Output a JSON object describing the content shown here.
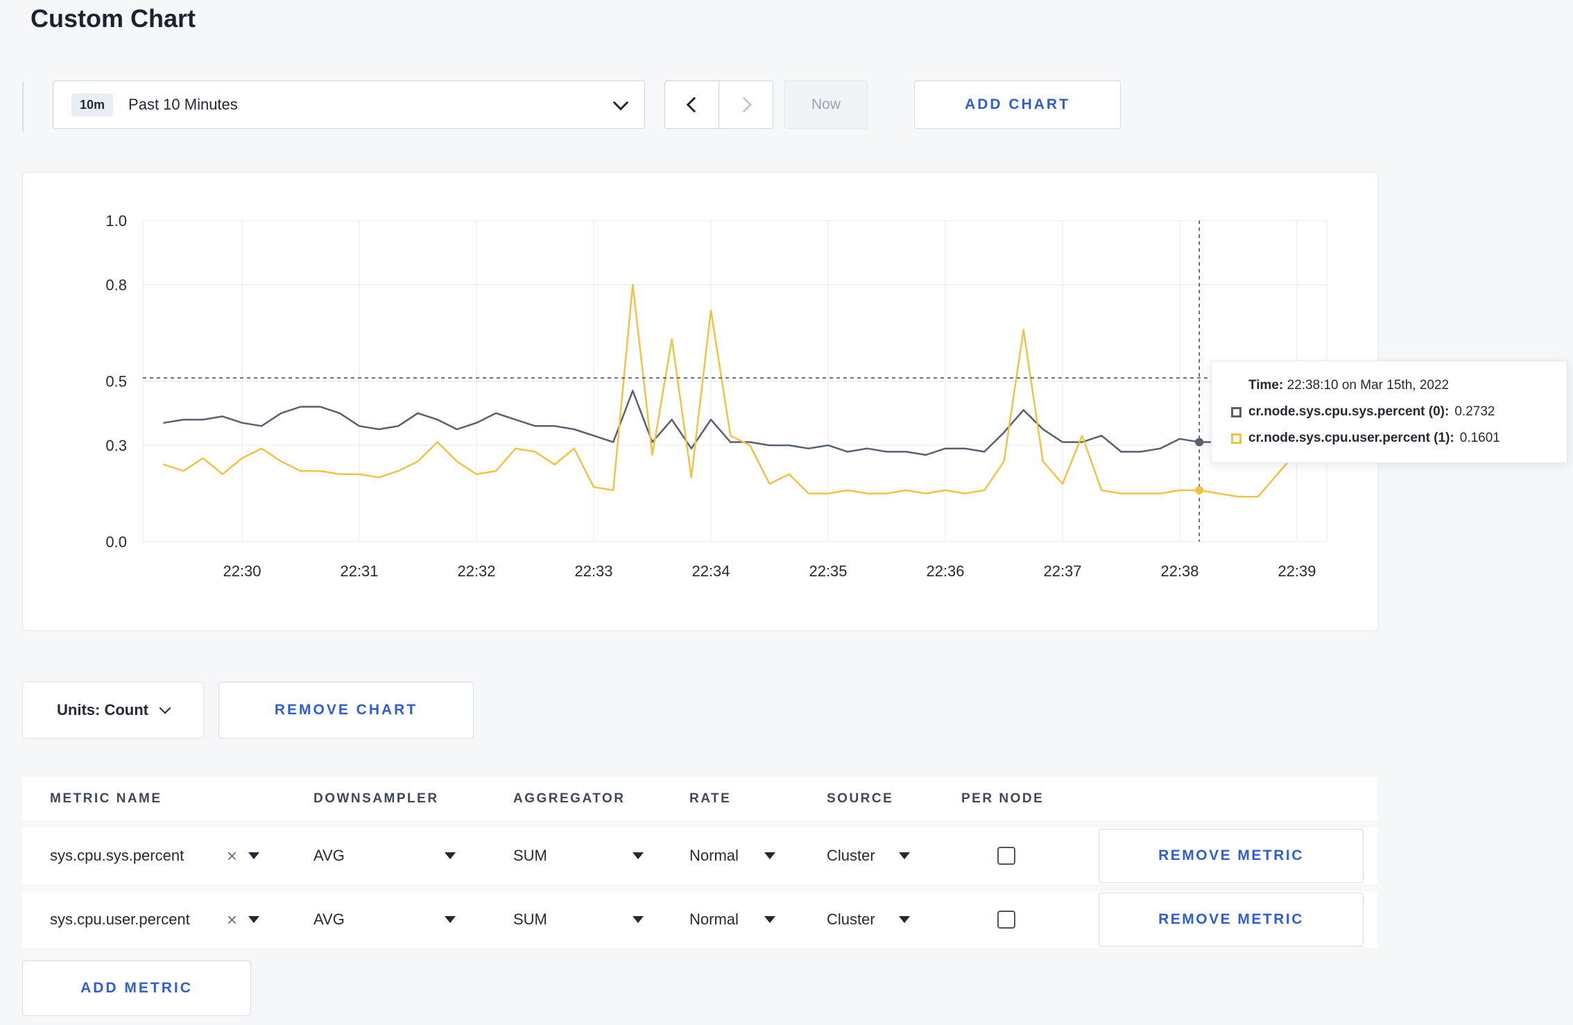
{
  "page": {
    "title": "Custom Chart"
  },
  "colors": {
    "accent_blue": "#2f5ed2",
    "series_sys": "#57606f",
    "series_user": "#f2c243",
    "page_bg": "#f6f7f9"
  },
  "icons": {
    "clear": "×"
  },
  "toolbar": {
    "range_badge": "10m",
    "range_label": "Past 10 Minutes",
    "now_label": "Now",
    "add_chart_label": "ADD CHART"
  },
  "chart": {
    "tooltip": {
      "time_label": "Time:",
      "time_value": "22:38:10 on Mar 15th, 2022",
      "entries": [
        {
          "label": "cr.node.sys.cpu.sys.percent (0):",
          "value": "0.2732",
          "color": "#57606f"
        },
        {
          "label": "cr.node.sys.cpu.user.percent (1):",
          "value": "0.1601",
          "color": "#f2c243"
        }
      ]
    }
  },
  "controls": {
    "units_label": "Units: Count",
    "remove_chart_label": "REMOVE CHART"
  },
  "metrics_table": {
    "headers": [
      "METRIC NAME",
      "DOWNSAMPLER",
      "AGGREGATOR",
      "RATE",
      "SOURCE",
      "PER NODE"
    ],
    "rows": [
      {
        "metric": "sys.cpu.sys.percent",
        "downsampler": "AVG",
        "aggregator": "SUM",
        "rate": "Normal",
        "source": "Cluster",
        "per_node_checked": false,
        "remove_label": "REMOVE METRIC"
      },
      {
        "metric": "sys.cpu.user.percent",
        "downsampler": "AVG",
        "aggregator": "SUM",
        "rate": "Normal",
        "source": "Cluster",
        "per_node_checked": false,
        "remove_label": "REMOVE METRIC"
      }
    ],
    "add_metric_label": "ADD METRIC"
  },
  "chart_data": {
    "type": "line",
    "title": "",
    "xlabel": "",
    "ylabel": "",
    "ylim": [
      0,
      1.0
    ],
    "grid": true,
    "x_ticks": [
      "22:30",
      "22:31",
      "22:32",
      "22:33",
      "22:34",
      "22:35",
      "22:36",
      "22:37",
      "22:38",
      "22:39"
    ],
    "y_ticks": [
      0.0,
      0.3,
      0.5,
      0.8,
      1.0
    ],
    "x_tick_interval_s": 60,
    "point_interval_s": 10,
    "first_point_offset_s": -40,
    "series": [
      {
        "name": "cr.node.sys.cpu.sys.percent",
        "color": "#57606f",
        "values": [
          0.37,
          0.38,
          0.38,
          0.39,
          0.37,
          0.36,
          0.4,
          0.42,
          0.42,
          0.4,
          0.36,
          0.35,
          0.36,
          0.4,
          0.38,
          0.35,
          0.37,
          0.4,
          0.38,
          0.36,
          0.36,
          0.35,
          0.33,
          0.31,
          0.47,
          0.31,
          0.38,
          0.29,
          0.38,
          0.31,
          0.31,
          0.3,
          0.3,
          0.29,
          0.3,
          0.28,
          0.29,
          0.28,
          0.28,
          0.27,
          0.29,
          0.29,
          0.28,
          0.34,
          0.41,
          0.35,
          0.31,
          0.31,
          0.33,
          0.28,
          0.28,
          0.29,
          0.32,
          0.31,
          0.31,
          0.3,
          0.3,
          0.3,
          0.31
        ]
      },
      {
        "name": "cr.node.sys.cpu.user.percent",
        "color": "#f2c243",
        "values": [
          0.24,
          0.22,
          0.26,
          0.21,
          0.26,
          0.29,
          0.25,
          0.22,
          0.22,
          0.21,
          0.21,
          0.2,
          0.22,
          0.25,
          0.31,
          0.25,
          0.21,
          0.22,
          0.29,
          0.28,
          0.24,
          0.29,
          0.17,
          0.16,
          0.8,
          0.27,
          0.63,
          0.2,
          0.72,
          0.33,
          0.3,
          0.18,
          0.21,
          0.15,
          0.15,
          0.16,
          0.15,
          0.15,
          0.16,
          0.15,
          0.16,
          0.15,
          0.16,
          0.25,
          0.66,
          0.25,
          0.18,
          0.33,
          0.16,
          0.15,
          0.15,
          0.15,
          0.16,
          0.16,
          0.15,
          0.14,
          0.14,
          0.21,
          0.28
        ]
      }
    ],
    "crosshair": {
      "time_label": "22:38:10",
      "seconds_after_first_tick": 490,
      "hline_value": 0.51,
      "highlight": [
        {
          "series": 0,
          "value": 0.31
        },
        {
          "series": 1,
          "value": 0.16
        }
      ]
    }
  }
}
